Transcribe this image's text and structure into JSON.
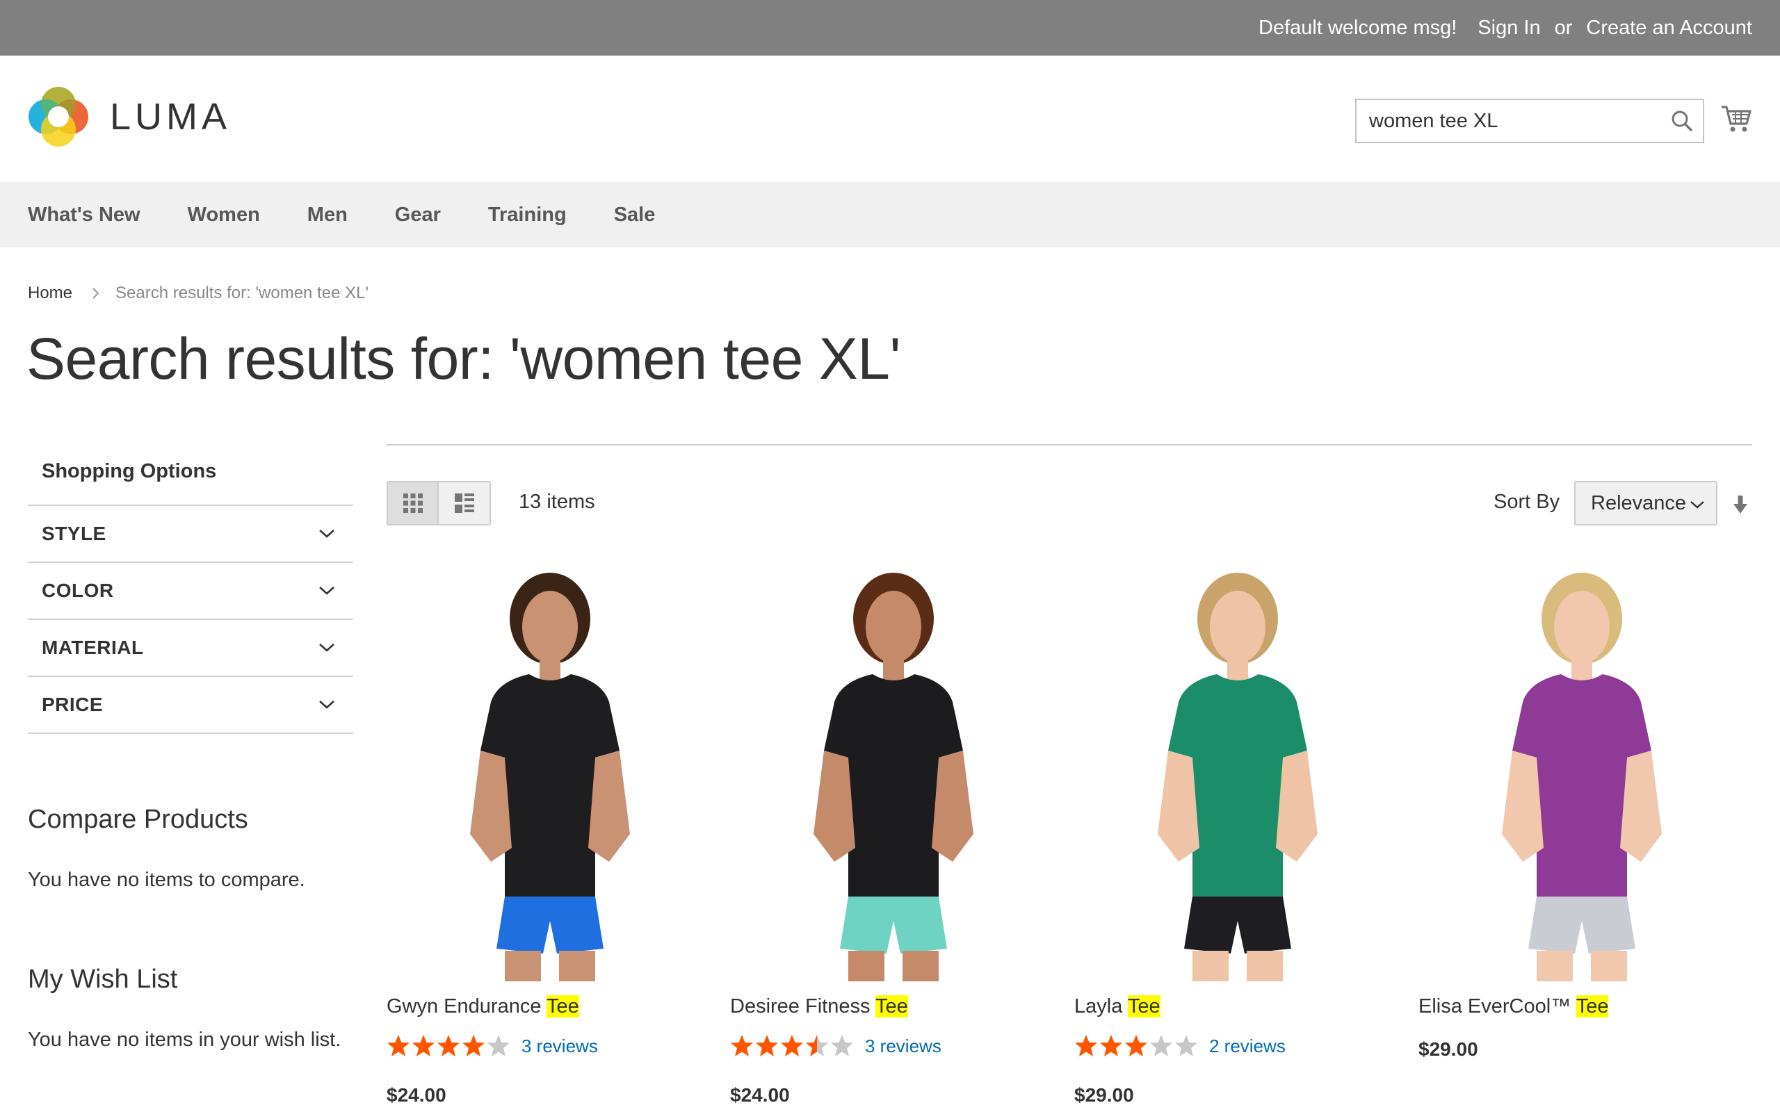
{
  "top_bar": {
    "welcome": "Default welcome msg!",
    "sign_in": "Sign In",
    "or": "or",
    "create_account": "Create an Account"
  },
  "header": {
    "logo_text": "LUMA",
    "search_value": "women tee XL"
  },
  "nav": {
    "items": [
      "What's New",
      "Women",
      "Men",
      "Gear",
      "Training",
      "Sale"
    ]
  },
  "breadcrumb": {
    "home": "Home",
    "current": "Search results for: 'women tee XL'"
  },
  "page_title": "Search results for: 'women tee XL'",
  "sidebar": {
    "shopping_options": "Shopping Options",
    "filters": [
      "STYLE",
      "COLOR",
      "MATERIAL",
      "PRICE"
    ],
    "compare_title": "Compare Products",
    "compare_text": "You have no items to compare.",
    "wishlist_title": "My Wish List",
    "wishlist_text": "You have no items in your wish list."
  },
  "toolbar": {
    "items_count": "13 items",
    "sort_label": "Sort By",
    "sort_value": "Relevance"
  },
  "products": [
    {
      "name_prefix": "Gwyn Endurance ",
      "name_highlight": "Tee",
      "rating_fraction": 0.8,
      "reviews": "3 reviews",
      "price": "$24.00",
      "shirt_color": "#1e1e20",
      "shorts_color": "#1f6fe0"
    },
    {
      "name_prefix": "Desiree Fitness ",
      "name_highlight": "Tee",
      "rating_fraction": 0.7,
      "reviews": "3 reviews",
      "price": "$24.00",
      "shirt_color": "#1c1c1e",
      "shorts_color": "#6fd3c4"
    },
    {
      "name_prefix": "Layla ",
      "name_highlight": "Tee",
      "rating_fraction": 0.6,
      "reviews": "2 reviews",
      "price": "$29.00",
      "shirt_color": "#1b8d68",
      "shorts_color": "#1d1d22"
    },
    {
      "name_prefix": "Elisa EverCool™ ",
      "name_highlight": "Tee",
      "rating_fraction": null,
      "reviews": null,
      "price": "$29.00",
      "shirt_color": "#8e3a96",
      "shorts_color": "#c9ccd2"
    }
  ],
  "colors": {
    "top_bar": "#7f807f",
    "nav_bg": "#f0f0f0",
    "star_on": "#ff5501",
    "star_off": "#c7c7c7",
    "link": "#006bb4",
    "highlight": "#ffff00"
  }
}
